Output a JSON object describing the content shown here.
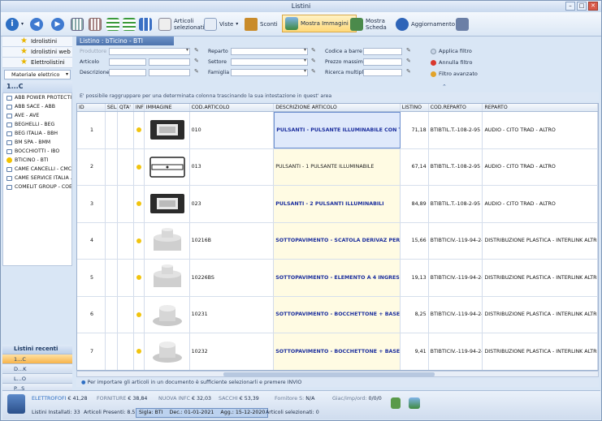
{
  "window": {
    "title": "Listini"
  },
  "toolbar": {
    "articoli_selezionati": "Articoli selezionati",
    "viste": "Viste",
    "sconti": "Sconti",
    "mostra_immagini": "Mostra Immagini",
    "mostra_scheda": "Mostra Scheda",
    "aggiornamento": "Aggiornamento"
  },
  "left": {
    "top_items": [
      "Idrolistini",
      "Idrolistini web",
      "Elettrolistini"
    ],
    "category": "Materiale elettrico",
    "group_header": "1...C",
    "suppliers": [
      "ABB POWER PROTECTI...",
      "ABB SACE - ABB",
      "AVE - AVE",
      "BEGHELLI - BEG",
      "BEG ITALIA - BBH",
      "BM SPA - BMM",
      "BOCCHIOTTI - IBO",
      "BTICINO - BTI",
      "CAME CANCELLI - CMC",
      "CAME SERVICE ITALIA ...",
      "COMELIT GROUP - COE"
    ],
    "selected_supplier_index": 7,
    "recent_header": "Listini recenti",
    "recent": [
      "1...C",
      "D...K",
      "L...O",
      "P...S",
      "T...Z"
    ]
  },
  "listino": {
    "title": "Listino : bTicino - BTI"
  },
  "filters": {
    "produttore": "Produttore",
    "articolo": "Articolo",
    "descrizione": "Descrizione",
    "reparto": "Reparto",
    "settore": "Settore",
    "famiglia": "Famiglia",
    "codice_a_barre": "Codice a barre",
    "prezzo_massimo": "Prezzo massimo",
    "ricerca_multipla": "Ricerca multipla",
    "applica_filtro": "Applica filtro",
    "annulla_filtro": "Annulla filtro",
    "filtro_avanzato": "Filtro avanzato"
  },
  "group_hint": "E' possibile raggruppare per una determinata colonna trascinando la sua intestazione in quest' area",
  "grid": {
    "columns": [
      "ID",
      "SEL.",
      "QTA'",
      "INF",
      "IMMAGINE",
      "COD.ARTICOLO",
      "DESCRIZIONE ARTICOLO",
      "LISTINO",
      "COD.REPARTO",
      "REPARTO"
    ],
    "rows": [
      {
        "id": "1",
        "cod": "010",
        "desc": "PULSANTI - PULSANTE ILLUMINABILE CON TARGA",
        "listino": "71,18",
        "codrep": "BTIBTIL.T.-108-2-95",
        "reparto": "AUDIO - CITO TRAD - ALTRO",
        "img": "panel-dark",
        "bold": true
      },
      {
        "id": "2",
        "cod": "013",
        "desc": "PULSANTI - 1 PULSANTE ILLUMINABILE",
        "listino": "67,14",
        "codrep": "BTIBTIL.T.-108-2-95",
        "reparto": "AUDIO - CITO TRAD - ALTRO",
        "img": "panel-line",
        "bold": false
      },
      {
        "id": "3",
        "cod": "023",
        "desc": "PULSANTI - 2 PULSANTI ILLUMINABILI",
        "listino": "84,89",
        "codrep": "BTIBTIL.T.-108-2-95",
        "reparto": "AUDIO - CITO TRAD - ALTRO",
        "img": "panel-dark",
        "bold": true
      },
      {
        "id": "4",
        "cod": "10216B",
        "desc": "SOTTOPAVIMENTO - SCATOLA DERIVAZ PER 10206",
        "listino": "15,66",
        "codrep": "BTIBTICIV.-119-94-244",
        "reparto": "DISTRIBUZIONE PLASTICA - INTERLINK ALTRO",
        "img": "box-grey",
        "bold": true
      },
      {
        "id": "5",
        "cod": "10226BS",
        "desc": "SOTTOPAVIMENTO - ELEMENTO A 4 INGRESSI",
        "listino": "19,13",
        "codrep": "BTIBTICIV.-119-94-244",
        "reparto": "DISTRIBUZIONE PLASTICA - INTERLINK ALTRO",
        "img": "box-grey",
        "bold": true
      },
      {
        "id": "6",
        "cod": "10231",
        "desc": "SOTTOPAVIMENTO - BOCCHETTONE + BASE",
        "listino": "8,25",
        "codrep": "BTIBTICIV.-119-94-244",
        "reparto": "DISTRIBUZIONE PLASTICA - INTERLINK ALTRO",
        "img": "cyl-grey",
        "bold": true
      },
      {
        "id": "7",
        "cod": "10232",
        "desc": "SOTTOPAVIMENTO - BOCCHETTONE + BASE",
        "listino": "9,41",
        "codrep": "BTIBTICIV.-119-94-244",
        "reparto": "DISTRIBUZIONE PLASTICA - INTERLINK ALTRO",
        "img": "cyl-grey",
        "bold": true
      }
    ]
  },
  "info_line": "Per importare gli articoli in un documento è sufficiente selezionarli e premere INVIO",
  "status": {
    "elettroforti_label": "ELETTROFOFI",
    "elettroforti_value": "€ 41,28",
    "forniture_label": "FORNITURE",
    "forniture_value": "€ 38,84",
    "nuova_infc_label": "NUOVA INFC",
    "nuova_infc_value": "€ 32,03",
    "sacchi_label": "SACCHI",
    "sacchi_value": "€ 53,39",
    "fornitore_s_label": "Fornitore S:",
    "fornitore_s_value": "N/A",
    "giac_label": "Giac/imp/ord:",
    "giac_value": "0/0/0",
    "listini_installati": "Listini Installati: 33",
    "articoli_presenti": "Articoli Presenti: 8.518",
    "sigla": "Sigla: BTI",
    "dec": "Dec.: 01-01-2021",
    "agg": "Agg.: 15-12-2020",
    "articoli_selezionati": "Articoli selezionati: 0"
  }
}
